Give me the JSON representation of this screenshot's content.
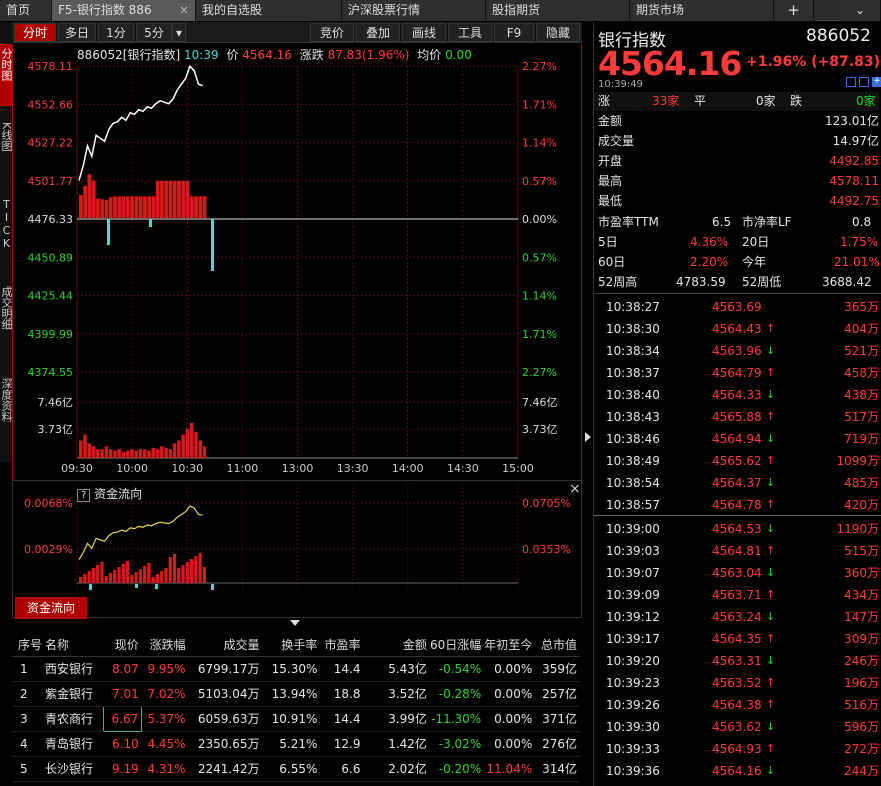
{
  "tabs": [
    {
      "label": "首页"
    },
    {
      "label": "F5-银行指数 886"
    },
    {
      "label": "我的自选股"
    },
    {
      "label": "沪深股票行情"
    },
    {
      "label": "股指期货"
    },
    {
      "label": "期货市场"
    }
  ],
  "tab_plus": "+",
  "tab_close": "×",
  "tab_arrow": "⌄",
  "toolbar": {
    "left": [
      "分时",
      "多日",
      "1分",
      "5分"
    ],
    "dropdown": "▾",
    "right": [
      "竞价",
      "叠加",
      "画线",
      "工具",
      "F9",
      "隐藏"
    ]
  },
  "left_nav": [
    "分时图",
    "K线图",
    "TICK",
    "成交明细",
    "深度资料"
  ],
  "chart_info": {
    "code": "886052[银行指数]",
    "time": "10:39",
    "price_label": "价",
    "price": "4564.16",
    "change_label": "涨跌",
    "change": "87.83(1.96%)",
    "avg_label": "均价",
    "avg": "0.00"
  },
  "chart_data": {
    "type": "line",
    "x_ticks": [
      "09:30",
      "10:00",
      "10:30",
      "11:00",
      "13:00",
      "13:30",
      "14:00",
      "14:30",
      "15:00"
    ],
    "y_left_ticks": [
      "4578.11",
      "4552.66",
      "4527.22",
      "4501.77",
      "4476.33",
      "4450.89",
      "4425.44",
      "4399.99",
      "4374.55"
    ],
    "y_right_ticks": [
      "2.27%",
      "1.71%",
      "1.14%",
      "0.57%",
      "0.00%",
      "0.57%",
      "1.14%",
      "1.71%",
      "2.27%"
    ],
    "ylim": [
      4374.55,
      4578.11
    ],
    "base": 4476.33,
    "volume_ticks": [
      "7.46亿",
      "3.73亿"
    ],
    "price_series": [
      4502,
      4512,
      4525,
      4518,
      4532,
      4530,
      4528,
      4536,
      4540,
      4541,
      4544,
      4542,
      4547,
      4546,
      4549,
      4548,
      4551,
      4550,
      4553,
      4555,
      4554,
      4553,
      4556,
      4562,
      4566,
      4570,
      4578,
      4575,
      4566,
      4565
    ],
    "volume_series": [
      0.6,
      0.8,
      0.5,
      0.4,
      0.3,
      0.3,
      0.4,
      0.3,
      0.25,
      0.3,
      0.2,
      0.25,
      0.3,
      0.25,
      0.3,
      0.3,
      0.25,
      0.35,
      0.3,
      0.4,
      0.35,
      0.3,
      0.5,
      0.6,
      0.8,
      1.0,
      1.2,
      0.9,
      0.6,
      0.4
    ]
  },
  "fund_flow": {
    "help": "?",
    "title": "资金流向",
    "left_ticks": [
      "0.0068%",
      "0.0029%"
    ],
    "right_ticks": [
      "0.0705%",
      "0.0353%"
    ],
    "tab": "资金流向",
    "close": "×"
  },
  "table": {
    "headers": [
      "序号",
      "名称",
      "现价",
      "涨跌幅",
      "成交量",
      "换手率",
      "市盈率",
      "金额",
      "60日涨幅",
      "年初至今",
      "总市值"
    ],
    "rows": [
      {
        "no": "1",
        "name": "西安银行",
        "price": "8.07",
        "pct": "9.95%",
        "vol": "6799.17万",
        "turnover": "15.30%",
        "pe": "14.4",
        "amount": "5.43亿",
        "d60": "-0.54%",
        "ytd": "0.00%",
        "cap": "359亿"
      },
      {
        "no": "2",
        "name": "紫金银行",
        "price": "7.01",
        "pct": "7.02%",
        "vol": "5103.04万",
        "turnover": "13.94%",
        "pe": "18.8",
        "amount": "3.52亿",
        "d60": "-0.28%",
        "ytd": "0.00%",
        "cap": "257亿"
      },
      {
        "no": "3",
        "name": "青农商行",
        "price": "6.67",
        "pct": "5.37%",
        "vol": "6059.63万",
        "turnover": "10.91%",
        "pe": "14.4",
        "amount": "3.99亿",
        "d60": "-11.30%",
        "ytd": "0.00%",
        "cap": "371亿"
      },
      {
        "no": "4",
        "name": "青岛银行",
        "price": "6.10",
        "pct": "4.45%",
        "vol": "2350.65万",
        "turnover": "5.21%",
        "pe": "12.9",
        "amount": "1.42亿",
        "d60": "-3.02%",
        "ytd": "0.00%",
        "cap": "276亿"
      },
      {
        "no": "5",
        "name": "长沙银行",
        "price": "9.19",
        "pct": "4.31%",
        "vol": "2241.42万",
        "turnover": "6.55%",
        "pe": "6.6",
        "amount": "2.02亿",
        "d60": "-0.20%",
        "ytd": "11.04%",
        "cap": "314亿"
      }
    ]
  },
  "right": {
    "name": "银行指数",
    "code": "886052",
    "price": "4564.16",
    "change": "+1.96% (+87.83)",
    "time": "10:39:49",
    "rise_label": "涨",
    "rise": "33家",
    "flat_label": "平",
    "flat": "0家",
    "fall_label": "跌",
    "fall": "0家",
    "stats": [
      {
        "label": "金额",
        "value": "123.01亿",
        "cls": "white"
      },
      {
        "label": "成交量",
        "value": "14.97亿",
        "cls": "white"
      },
      {
        "label": "开盘",
        "value": "4492.85",
        "cls": "red"
      },
      {
        "label": "最高",
        "value": "4578.11",
        "cls": "red"
      },
      {
        "label": "最低",
        "value": "4492.75",
        "cls": "red"
      }
    ],
    "pe_label": "市盈率TTM",
    "pe": "6.5",
    "pb_label": "市净率LF",
    "pb": "0.8",
    "d5_label": "5日",
    "d5": "4.36%",
    "d20_label": "20日",
    "d20": "1.75%",
    "d60_label": "60日",
    "d60": "2.20%",
    "ytd_label": "今年",
    "ytd": "21.01%",
    "w52h_label": "52周高",
    "w52h": "4783.59",
    "w52l_label": "52周低",
    "w52l": "3688.42",
    "ticks": [
      {
        "t": "10:38:27",
        "p": "4563.69",
        "d": "",
        "v": "365万"
      },
      {
        "t": "10:38:30",
        "p": "4564.43",
        "d": "up",
        "v": "404万"
      },
      {
        "t": "10:38:34",
        "p": "4563.96",
        "d": "down",
        "v": "521万"
      },
      {
        "t": "10:38:37",
        "p": "4564.79",
        "d": "up",
        "v": "458万"
      },
      {
        "t": "10:38:40",
        "p": "4564.33",
        "d": "down",
        "v": "438万"
      },
      {
        "t": "10:38:43",
        "p": "4565.88",
        "d": "up",
        "v": "517万"
      },
      {
        "t": "10:38:46",
        "p": "4564.94",
        "d": "down",
        "v": "719万"
      },
      {
        "t": "10:38:49",
        "p": "4565.62",
        "d": "up",
        "v": "1099万"
      },
      {
        "t": "10:38:54",
        "p": "4564.37",
        "d": "down",
        "v": "485万"
      },
      {
        "t": "10:38:57",
        "p": "4564.78",
        "d": "up",
        "v": "420万"
      },
      {
        "t": "10:39:00",
        "p": "4564.53",
        "d": "down",
        "v": "1190万"
      },
      {
        "t": "10:39:03",
        "p": "4564.81",
        "d": "up",
        "v": "515万"
      },
      {
        "t": "10:39:07",
        "p": "4563.04",
        "d": "down",
        "v": "360万"
      },
      {
        "t": "10:39:09",
        "p": "4563.71",
        "d": "up",
        "v": "434万"
      },
      {
        "t": "10:39:12",
        "p": "4563.24",
        "d": "down",
        "v": "147万"
      },
      {
        "t": "10:39:17",
        "p": "4564.35",
        "d": "up",
        "v": "309万"
      },
      {
        "t": "10:39:20",
        "p": "4563.31",
        "d": "down",
        "v": "246万"
      },
      {
        "t": "10:39:23",
        "p": "4563.52",
        "d": "up",
        "v": "196万"
      },
      {
        "t": "10:39:26",
        "p": "4564.38",
        "d": "up",
        "v": "516万"
      },
      {
        "t": "10:39:30",
        "p": "4563.62",
        "d": "down",
        "v": "596万"
      },
      {
        "t": "10:39:33",
        "p": "4564.93",
        "d": "up",
        "v": "272万"
      },
      {
        "t": "10:39:36",
        "p": "4564.16",
        "d": "down",
        "v": "244万"
      }
    ]
  }
}
